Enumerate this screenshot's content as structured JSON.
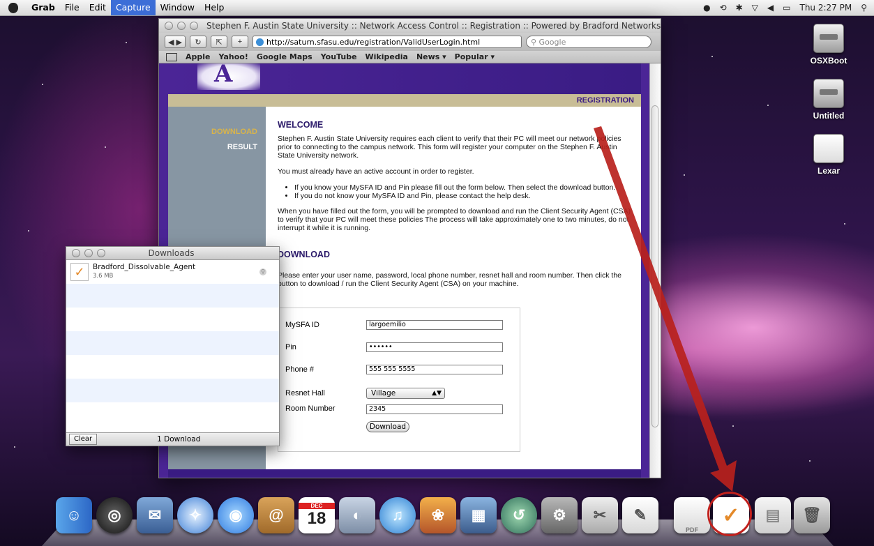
{
  "menubar": {
    "app": "Grab",
    "items": [
      "File",
      "Edit",
      "Capture",
      "Window",
      "Help"
    ],
    "selected": "Capture",
    "clock": "Thu 2:27 PM"
  },
  "desktop_icons": [
    {
      "label": "OSXBoot",
      "icon": "hard-drive-icon"
    },
    {
      "label": "Untitled",
      "icon": "hard-drive-icon"
    },
    {
      "label": "Lexar",
      "icon": "removable-drive-icon"
    }
  ],
  "browser": {
    "title": "Stephen F. Austin State University :: Network Access Control :: Registration :: Powered by Bradford Networks",
    "url": "http://saturn.sfasu.edu/registration/ValidUserLogin.html",
    "search_placeholder": "Google",
    "bookmarks": [
      "Apple",
      "Yahoo!",
      "Google Maps",
      "YouTube",
      "Wikipedia",
      "News ▾",
      "Popular ▾"
    ],
    "logo_text": "A",
    "registration_label": "REGISTRATION",
    "nav": {
      "download": "DOWNLOAD",
      "result": "RESULT"
    },
    "welcome_heading": "WELCOME",
    "welcome_p1": "Stephen F. Austin State University requires each client to verify that their PC will meet our network policies prior to connecting to the campus network. This form will register your computer on the Stephen F. Austin State University network.",
    "welcome_p2": "You must already have an active account in order to register.",
    "bullet1": "If you know your MySFA ID and Pin please fill out the form below. Then select the download button.",
    "bullet2": "If you do not know your MySFA ID and Pin, please contact the help desk.",
    "welcome_p3": "When you have filled out the form, you will be prompted to download and run the Client Security Agent (CSA) to verify that your PC will meet these policies The process will take approximately one to two minutes, do not interrupt it while it is running.",
    "download_heading": "DOWNLOAD",
    "download_p": "Please enter your user name, password, local phone number, resnet hall and room number. Then click the button to download / run the Client Security Agent (CSA) on your machine.",
    "form": {
      "mysfa_label": "MySFA ID",
      "mysfa_value": "largoemilio",
      "pin_label": "Pin",
      "pin_value": "••••••",
      "phone_label": "Phone #",
      "phone_value": "555 555 5555",
      "hall_label": "Resnet Hall",
      "hall_value": "Village",
      "room_label": "Room Number",
      "room_value": "2345",
      "download_button": "Download"
    }
  },
  "downloads": {
    "title": "Downloads",
    "item_name": "Bradford_Dissolvable_Agent",
    "item_size": "3.6 MB",
    "clear_button": "Clear",
    "count": "1 Download"
  },
  "dock": {
    "calendar_month": "DEC",
    "calendar_day": "18",
    "pdf_label": "PDF"
  },
  "colors": {
    "accent_red": "#c0201c",
    "sfa_purple": "#4b2596",
    "sfa_gold": "#c8bd96"
  }
}
